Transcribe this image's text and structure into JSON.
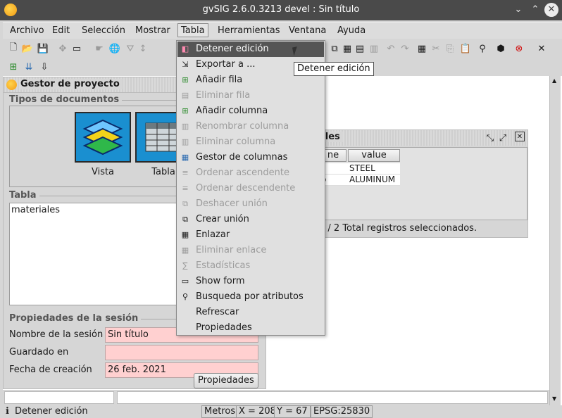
{
  "window": {
    "title": "gvSIG 2.6.0.3213 devel : Sin título"
  },
  "menubar": [
    "Archivo",
    "Edit",
    "Selección",
    "Mostrar",
    "Tabla",
    "Herramientas",
    "Ventana",
    "Ayuda"
  ],
  "active_menu": "Tabla",
  "tabla_menu": [
    {
      "label": "Detener edición",
      "icon": "stop-edit-icon",
      "enabled": true,
      "highlighted": true
    },
    {
      "label": "Exportar a ...",
      "icon": "export-icon",
      "enabled": true
    },
    {
      "label": "Añadir fila",
      "icon": "add-row-icon",
      "enabled": true
    },
    {
      "label": "Eliminar fila",
      "icon": "delete-row-icon",
      "enabled": false
    },
    {
      "label": "Añadir columna",
      "icon": "add-column-icon",
      "enabled": true
    },
    {
      "label": "Renombrar columna",
      "icon": "rename-column-icon",
      "enabled": false
    },
    {
      "label": "Eliminar columna",
      "icon": "delete-column-icon",
      "enabled": false
    },
    {
      "label": "Gestor de columnas",
      "icon": "column-manager-icon",
      "enabled": true
    },
    {
      "label": "Ordenar ascendente",
      "icon": "sort-asc-icon",
      "enabled": false
    },
    {
      "label": "Ordenar descendente",
      "icon": "sort-desc-icon",
      "enabled": false
    },
    {
      "label": "Deshacer unión",
      "icon": "undo-join-icon",
      "enabled": false
    },
    {
      "label": "Crear unión",
      "icon": "create-join-icon",
      "enabled": true
    },
    {
      "label": "Enlazar",
      "icon": "link-icon",
      "enabled": true
    },
    {
      "label": "Eliminar enlace",
      "icon": "unlink-icon",
      "enabled": false
    },
    {
      "label": "Estadísticas",
      "icon": "statistics-icon",
      "enabled": false
    },
    {
      "label": "Show form",
      "icon": "form-icon",
      "enabled": true
    },
    {
      "label": "Busqueda por atributos",
      "icon": "binoculars-icon",
      "enabled": true
    },
    {
      "label": "Refrescar",
      "icon": "",
      "enabled": true
    },
    {
      "label": "Propiedades",
      "icon": "",
      "enabled": true
    }
  ],
  "tooltip": "Detener edición",
  "project_manager": {
    "title": "Gestor de proyecto",
    "doc_types_label": "Tipos de documentos",
    "doc_types": [
      {
        "label": "Vista",
        "icon": "map-layers-icon"
      },
      {
        "label": "Tabla",
        "icon": "table-doc-icon"
      }
    ],
    "tables_label": "Tabla",
    "tables": [
      "materiales"
    ],
    "session_label": "Propiedades de la sesión",
    "session_name_label": "Nombre de la sesión",
    "session_name": "Sin título",
    "saved_in_label": "Guardado en",
    "saved_in": "",
    "created_label": "Fecha de creación",
    "created": "26 feb. 2021",
    "properties_button": "Propiedades"
  },
  "table_window": {
    "title_fragment": "ales",
    "columns": [
      "ne",
      "value"
    ],
    "rows": [
      [
        "",
        "STEEL"
      ],
      [
        "o",
        "ALUMINUM"
      ]
    ],
    "status": "0 / 2 Total registros seleccionados."
  },
  "statusbar": {
    "message": "Detener edición",
    "units": "Metros",
    "x": "X = 208",
    "y": "Y = 67",
    "epsg": "EPSG:25830"
  },
  "colors": {
    "titlebar": "#4a4a4a",
    "menu_highlight": "#555555",
    "required_field": "#ffd0d0",
    "panel": "#d6d6d6"
  }
}
